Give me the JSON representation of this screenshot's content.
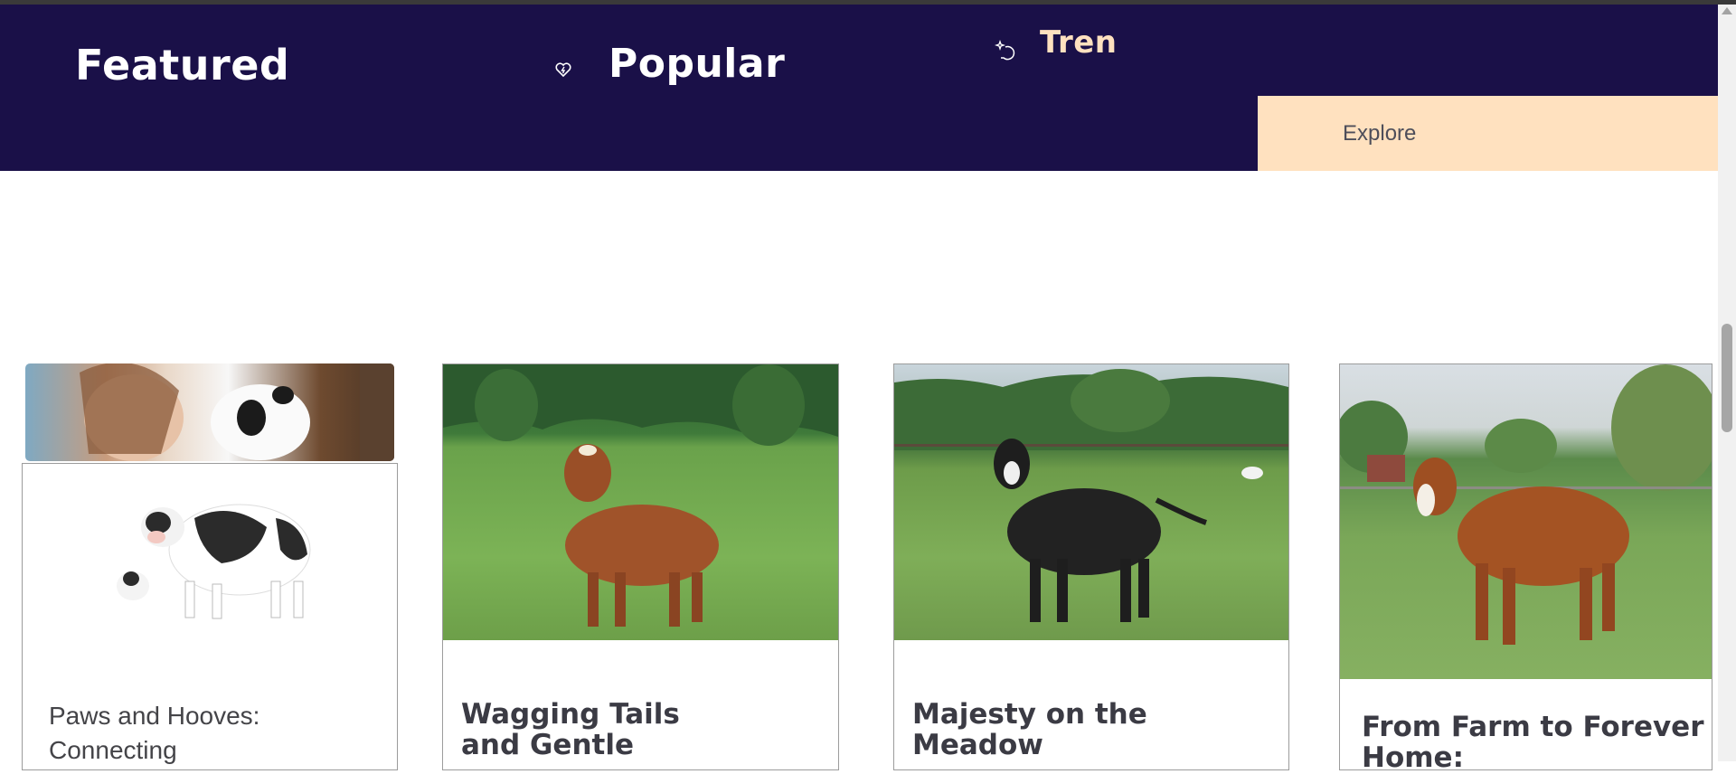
{
  "header": {
    "nav": [
      {
        "label": "Featured"
      },
      {
        "label": "Popular",
        "icon": "heart-icon"
      },
      {
        "label": "Tren",
        "icon": "sparkle-icon"
      }
    ],
    "explore_label": "Explore",
    "colors": {
      "background": "#1a1048",
      "accent": "#ffe1bf"
    }
  },
  "cards": [
    {
      "title": "Paws and Hooves:\nConnecting",
      "image": "girl-hugging-calf and holstein-cow-with-calf"
    },
    {
      "title": "Wagging Tails\nand Gentle",
      "image": "brown-cow-in-meadow"
    },
    {
      "title": "Majesty on the\nMeadow",
      "image": "black-cow-in-pasture"
    },
    {
      "title": "From Farm to Forever\nHome:",
      "image": "brown-cow-near-barn"
    }
  ]
}
